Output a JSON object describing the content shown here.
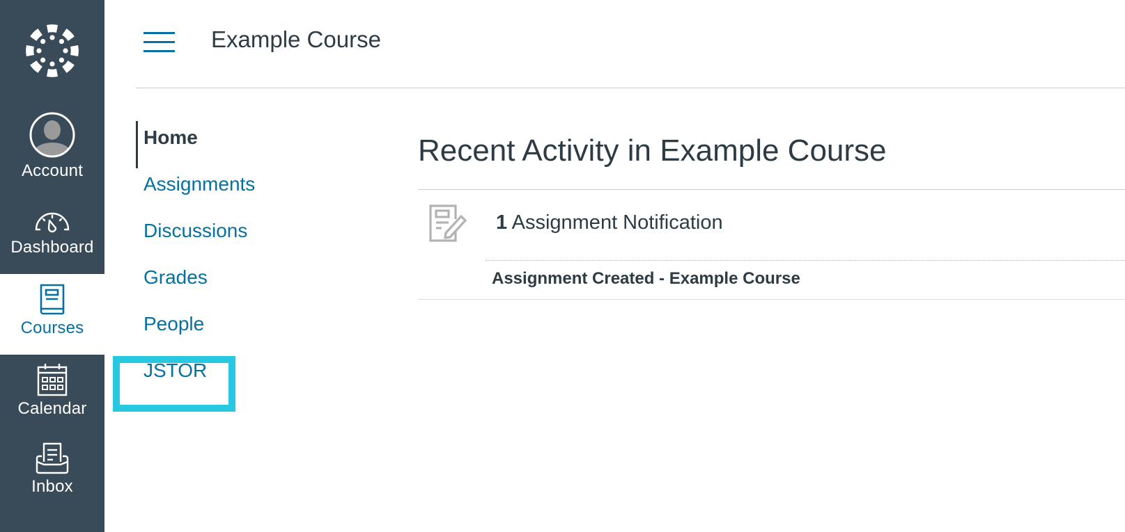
{
  "global_nav": {
    "logo": "canvas-logo-icon",
    "items": [
      {
        "label": "Account",
        "icon": "avatar-icon",
        "active": false
      },
      {
        "label": "Dashboard",
        "icon": "dashboard-gauge-icon",
        "active": false
      },
      {
        "label": "Courses",
        "icon": "book-icon",
        "active": true
      },
      {
        "label": "Calendar",
        "icon": "calendar-icon",
        "active": false
      },
      {
        "label": "Inbox",
        "icon": "inbox-icon",
        "active": false
      }
    ]
  },
  "header": {
    "menu_icon": "hamburger-icon",
    "course_title": "Example Course"
  },
  "course_nav": {
    "items": [
      {
        "label": "Home",
        "active": true
      },
      {
        "label": "Assignments",
        "active": false
      },
      {
        "label": "Discussions",
        "active": false
      },
      {
        "label": "Grades",
        "active": false
      },
      {
        "label": "People",
        "active": false
      },
      {
        "label": "JSTOR",
        "active": false,
        "highlighted": true
      }
    ]
  },
  "main": {
    "title": "Recent Activity in Example Course",
    "stream": [
      {
        "icon": "assignment-icon",
        "count": "1",
        "label": "Assignment Notification",
        "items": [
          "Assignment Created - Example Course"
        ]
      }
    ]
  },
  "colors": {
    "nav_bg": "#394B58",
    "link": "#0770A3",
    "text": "#2D3B45",
    "highlight": "#27C8E0"
  }
}
